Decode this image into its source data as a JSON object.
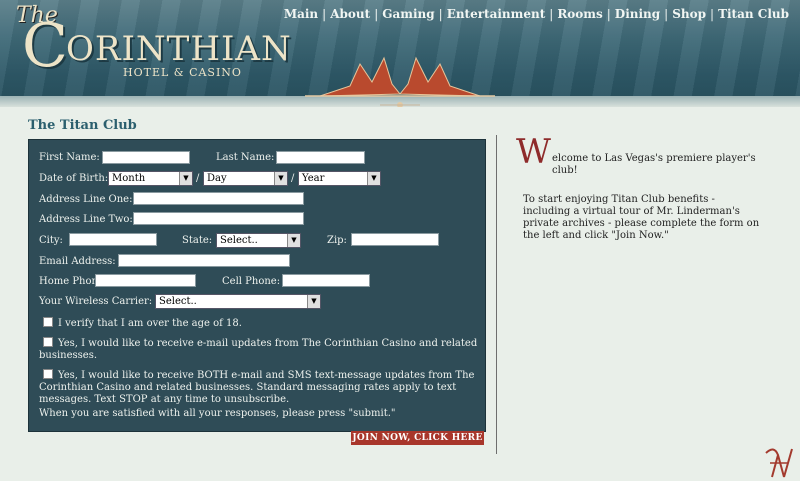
{
  "header": {
    "logo_the": "The",
    "logo_c": "C",
    "logo_main": "ORINTHIAN",
    "logo_sub": "HOTEL & CASINO",
    "nav": [
      "Main",
      "About",
      "Gaming",
      "Entertainment",
      "Rooms",
      "Dining",
      "Shop",
      "Titan Club"
    ]
  },
  "page_title": "The Titan Club",
  "form": {
    "first_name_label": "First Name:",
    "last_name_label": "Last Name:",
    "dob_label": "Date of Birth:",
    "month": "Month",
    "day": "Day",
    "year": "Year",
    "slash": "/",
    "addr1_label": "Address Line One:",
    "addr2_label": "Address Line Two:",
    "city_label": "City:",
    "state_label": "State:",
    "state_value": "Select..",
    "zip_label": "Zip:",
    "email_label": "Email Address:",
    "home_phone_label": "Home Phone:",
    "cell_phone_label": "Cell Phone:",
    "carrier_label": "Your Wireless Carrier:",
    "carrier_value": "Select..",
    "verify_age": "I verify that I am over the age of 18.",
    "email_updates": "Yes, I would like to receive e-mail updates from The Corinthian Casino and related businesses.",
    "sms_updates": "Yes, I would like to receive BOTH e-mail and SMS text-message updates from The Corinthian Casino and related businesses. Standard messaging rates apply to text messages. Text STOP at any time to unsubscribe.",
    "submit_note": "When you are satisfied with all your responses, please press \"submit.\"",
    "join_button": "JOIN NOW, CLICK HERE"
  },
  "welcome": {
    "big_w": "W",
    "line1": "elcome to Las Vegas's premiere player's club!",
    "body": "To start enjoying Titan Club benefits - including a virtual tour of Mr. Linderman's private archives - please complete the form on the left and click \"Join Now.\""
  },
  "colors": {
    "accent": "#a8362b",
    "form_bg": "#2f4c57",
    "title": "#2b5f6e"
  }
}
